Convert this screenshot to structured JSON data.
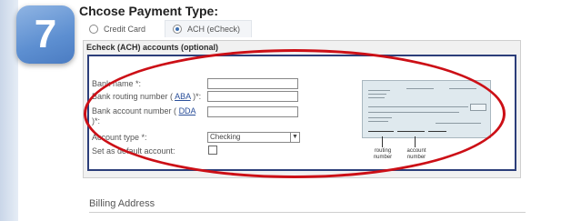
{
  "step": {
    "number": "7"
  },
  "payment": {
    "title": "Chcose Payment Type:",
    "options": [
      {
        "label": "Credit Card",
        "selected": false
      },
      {
        "label": "ACH (eCheck)",
        "selected": true
      }
    ]
  },
  "echeck": {
    "title": "Echeck (ACH) accounts (optional)",
    "fields": {
      "bank_name_label": "Bank name *:",
      "routing_label_prefix": "Bank routing number ( ",
      "routing_link": "ABA",
      "routing_label_suffix": " )*:",
      "account_label_prefix": "Bank account number ( ",
      "account_link": "DDA",
      "account_label_suffix": " )*:",
      "account_type_label": "Account type *:",
      "account_type_value": "Checking",
      "default_label": "Set as default account:"
    },
    "check_image": {
      "routing_caption_line1": "routing",
      "routing_caption_line2": "number",
      "account_caption_line1": "account",
      "account_caption_line2": "number"
    }
  },
  "billing": {
    "title": "Billing Address"
  },
  "colors": {
    "accent": "#5d8fd1",
    "border": "#2c3e7a",
    "highlight_oval": "#cc0f16"
  }
}
